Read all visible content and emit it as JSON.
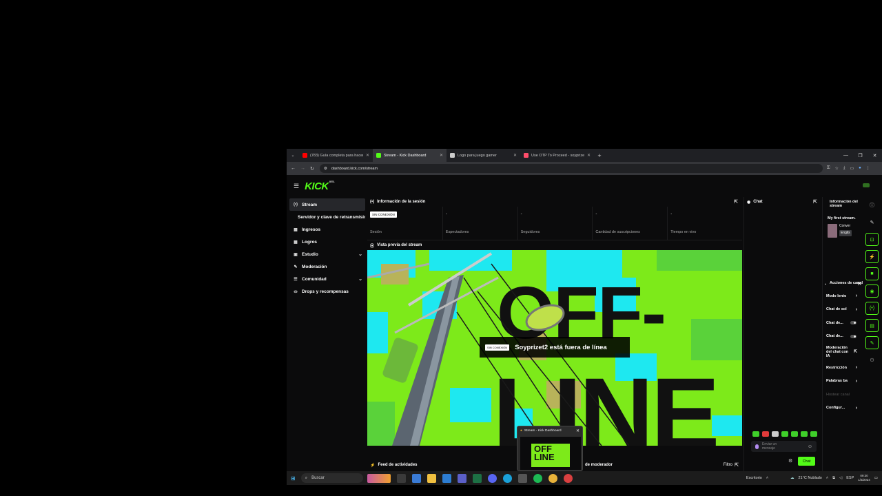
{
  "browser": {
    "tabs": [
      {
        "title": "(783) Guía completa para hacer",
        "icon": "youtube-icon",
        "color": "#ff0000",
        "active": false
      },
      {
        "title": "Stream - Kick Dashboard",
        "icon": "kick-icon",
        "color": "#53fc18",
        "active": true
      },
      {
        "title": "Logo para juego gamer",
        "icon": "chatgpt-icon",
        "color": "#cccccc",
        "active": false
      },
      {
        "title": "Use OTP To Proceed - soyprize",
        "icon": "shield-icon",
        "color": "#ff4d6a",
        "active": false
      }
    ],
    "url": "dashboard.kick.com/stream"
  },
  "app": {
    "logo": "KICK",
    "logo_tag": "BETA",
    "sidebar": [
      {
        "label": "Stream",
        "icon": "stream-icon",
        "glyph": "(•)",
        "active": true,
        "expand": false,
        "sub": false
      },
      {
        "label": "Servidor y clave de retransmisión",
        "icon": "",
        "glyph": "",
        "active": false,
        "expand": false,
        "sub": true
      },
      {
        "label": "Ingresos",
        "icon": "revenue-icon",
        "glyph": "▦",
        "active": false,
        "expand": false,
        "sub": false
      },
      {
        "label": "Logros",
        "icon": "achievements-icon",
        "glyph": "▦",
        "active": false,
        "expand": false,
        "sub": false
      },
      {
        "label": "Estudio",
        "icon": "studio-icon",
        "glyph": "▣",
        "active": false,
        "expand": true,
        "sub": false
      },
      {
        "label": "Moderación",
        "icon": "wrench-icon",
        "glyph": "✎",
        "active": false,
        "expand": false,
        "sub": false
      },
      {
        "label": "Comunidad",
        "icon": "community-icon",
        "glyph": "☰",
        "active": false,
        "expand": true,
        "sub": false
      },
      {
        "label": "Drops y recompensas",
        "icon": "drops-icon",
        "glyph": "⛀",
        "active": false,
        "expand": false,
        "sub": false
      }
    ],
    "session": {
      "title": "Información de la sesión",
      "status_badge": "SIN CONEXIÓN",
      "stats": [
        {
          "value": "",
          "label": "Sesión"
        },
        {
          "value": "-",
          "label": "Espectadores"
        },
        {
          "value": "-",
          "label": "Seguidores"
        },
        {
          "value": "-",
          "label": "Cantidad de suscripciones"
        },
        {
          "value": "-",
          "label": "Tiempo en vivo"
        }
      ]
    },
    "preview": {
      "title": "Vista previa del stream",
      "offline_badge": "SIN CONEXIÓN",
      "offline_message": "Soyprizet2 está fuera de línea",
      "art_text_top": "OFF-",
      "art_text_bottom": "LINE"
    },
    "feed": {
      "title": "Feed de actividades",
      "mod_title": "de moderador",
      "filter": "Filtro"
    },
    "chat": {
      "title": "Chat",
      "placeholder": "Enviar un mensaje",
      "button": "Chat"
    },
    "stream_info": {
      "title": "Información del stream",
      "stream_title": "My first stream.",
      "category": "Conver",
      "language": "Englis"
    },
    "channel_actions": {
      "title": "Acciones de canal",
      "items": [
        {
          "label": "Modo lento",
          "control": "chevron"
        },
        {
          "label": "Chat de sol",
          "control": "chevron"
        },
        {
          "label": "Chat de...",
          "control": "toggle"
        },
        {
          "label": "Chat de...",
          "control": "toggle"
        },
        {
          "label": "Moderación del chat con IA",
          "control": "external"
        },
        {
          "label": "Restricción",
          "control": "chevron"
        },
        {
          "label": "Palabras ba",
          "control": "chevron"
        },
        {
          "label": "Hostear canal",
          "control": "disabled"
        },
        {
          "label": "Configur...",
          "control": "chevron"
        }
      ]
    }
  },
  "taskbar": {
    "search_label": "Buscar",
    "preview_title": "Stream - Kick Dashboard",
    "preview_art": "OFF LINE",
    "desktop_label": "Escritorio",
    "weather": "21°C  Nublado",
    "lang": "ESP",
    "time": "09:30",
    "date": "1/3/2024"
  },
  "colors": {
    "kick_green": "#53fc18",
    "preview_cyan": "#1ee8f0",
    "preview_lime": "#7dea1a"
  }
}
